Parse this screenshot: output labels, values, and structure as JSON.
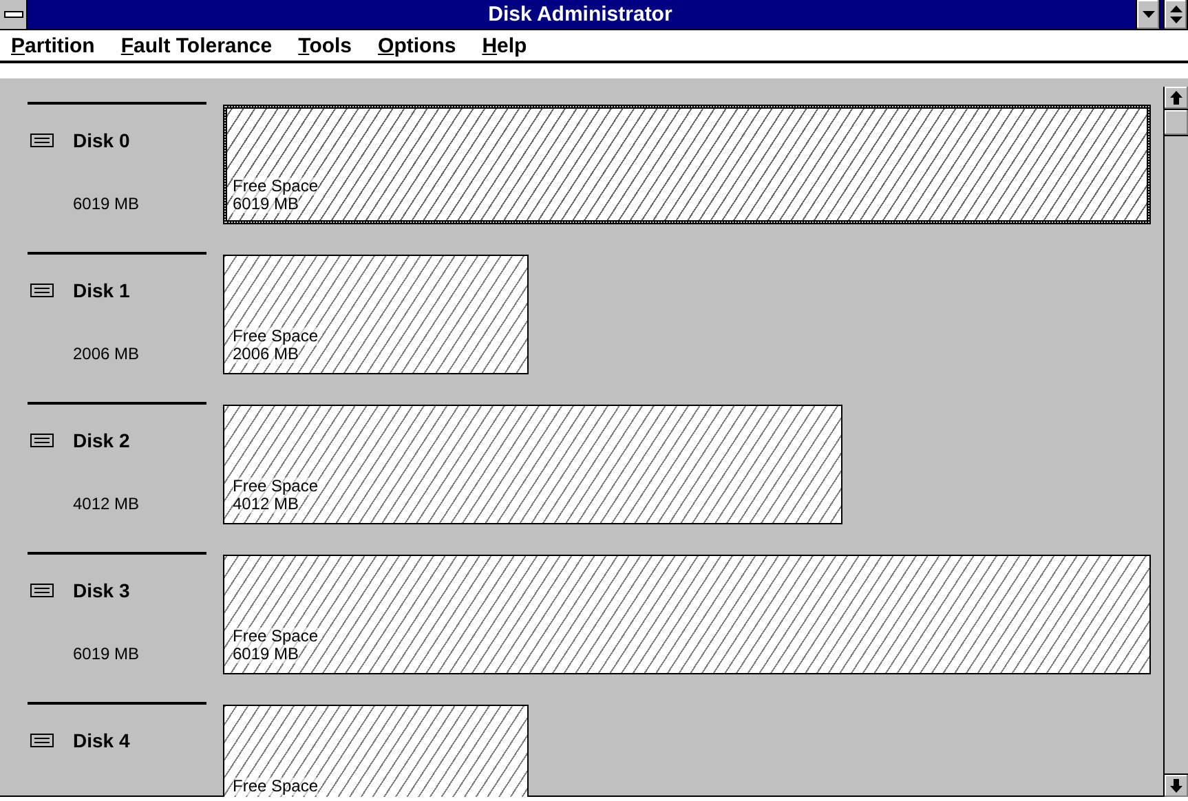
{
  "window": {
    "title": "Disk Administrator"
  },
  "menu": [
    {
      "label": "Partition"
    },
    {
      "label": "Fault Tolerance"
    },
    {
      "label": "Tools"
    },
    {
      "label": "Options"
    },
    {
      "label": "Help"
    }
  ],
  "disks": [
    {
      "name": "Disk 0",
      "size": "6019 MB",
      "partition": {
        "label": "Free Space",
        "size": "6019 MB",
        "kind": "full",
        "selected": true
      }
    },
    {
      "name": "Disk 1",
      "size": "2006 MB",
      "partition": {
        "label": "Free Space",
        "size": "2006 MB",
        "kind": "third",
        "selected": false
      }
    },
    {
      "name": "Disk 2",
      "size": "4012 MB",
      "partition": {
        "label": "Free Space",
        "size": "4012 MB",
        "kind": "twothirds",
        "selected": false
      }
    },
    {
      "name": "Disk 3",
      "size": "6019 MB",
      "partition": {
        "label": "Free Space",
        "size": "6019 MB",
        "kind": "full",
        "selected": false
      }
    },
    {
      "name": "Disk 4",
      "partition": {
        "label": "Free Space",
        "kind": "third",
        "selected": false
      }
    }
  ]
}
